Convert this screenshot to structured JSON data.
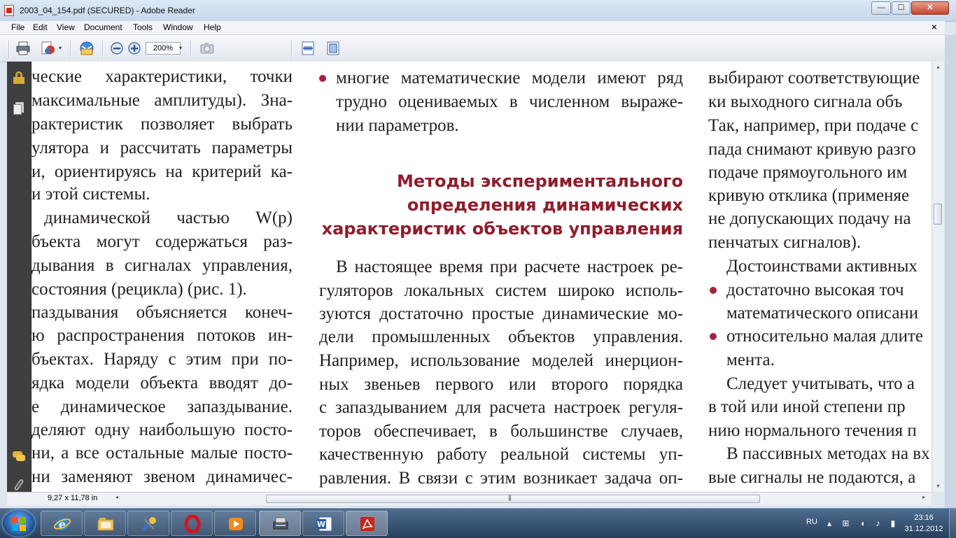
{
  "window": {
    "title": "2003_04_154.pdf (SECURED) - Adobe Reader",
    "min_glyph": "—",
    "max_glyph": "☐",
    "close_glyph": "✕"
  },
  "menu": {
    "items": [
      "File",
      "Edit",
      "View",
      "Document",
      "Tools",
      "Window",
      "Help"
    ],
    "close_glyph": "×"
  },
  "toolbar": {
    "zoom_value": "200%",
    "icons": [
      "print-icon",
      "collaborate-icon",
      "email-icon",
      "zoom-out-icon",
      "zoom-in-icon",
      "snapshot-icon",
      "fit-width-icon",
      "fit-page-icon"
    ]
  },
  "left_pane": {
    "icons": [
      "lock-icon",
      "pages-icon",
      "comment-icon",
      "attachment-icon"
    ]
  },
  "document": {
    "col1_lines": [
      "ческие характеристики, точки",
      "максимальные амплитуды). Зна-",
      "рактеристик позволяет выбрать",
      "улятора и рассчитать параметры",
      "и, ориентируясь на критерий ка-",
      "и этой системы.",
      "динамической частью W(p)",
      "бъекта могут содержаться раз-",
      "дывания в сигналах управления,",
      "состояния (рецикла) (рис. 1).",
      "паздывания объясняется конеч-",
      "ю распространения потоков ин-",
      "бъектах. Наряду с этим при по-",
      "ядка модели объекта вводят до-",
      "е динамическое запаздывание.",
      "деляют одну наибольшую посто-",
      "ни, а все остальные малые посто-",
      "ни заменяют звеном динамичес-"
    ],
    "col2_bullet_lines": [
      "многие математические модели имеют ряд",
      "трудно оцениваемых в численном выраже-",
      "нии параметров."
    ],
    "col2_heading_lines": [
      "Методы экспериментального",
      "определения динамических",
      "характеристик объектов управления"
    ],
    "col2_body_lines": [
      "В настоящее время при расчете настроек ре-",
      "гуляторов локальных систем широко исполь-",
      "зуются достаточно простые динамические мо-",
      "дели промышленных объектов управления.",
      "Например, использование моделей инерцион-",
      "ных звеньев первого или второго порядка",
      "с запаздыванием для расчета настроек регуля-",
      "торов обеспечивает, в большинстве случаев,",
      "качественную работу реальной системы уп-",
      "равления. В связи с этим возникает задача оп-"
    ],
    "col3_lines": [
      "выбирают соответствующие",
      "ки выходного сигнала объ",
      "Так, например, при подаче с",
      "пада снимают кривую разго",
      "подаче прямоугольного им",
      "кривую отклика (применяе",
      "не допускающих подачу на",
      "пенчатых сигналов).",
      "Достоинствами активных",
      "достаточно высокая точ",
      "математического описани",
      "относительно малая длите",
      "мента.",
      "Следует учитывать, что а",
      "в той или иной степени пр",
      "нию нормального течения п",
      "В пассивных методах на вх",
      "вые сигналы не подаются, а"
    ],
    "bullet_color": "#a5213b",
    "heading_color": "#8f1d2c"
  },
  "status": {
    "page_size": "9,27 x 11,78 in",
    "left_arrow": "◂",
    "right_arrow": "▸",
    "grip": "|||"
  },
  "scrollbar": {
    "up": "▴",
    "down": "▾"
  },
  "taskbar": {
    "apps": [
      "internet-explorer-icon",
      "explorer-icon",
      "tool-icon",
      "opera-icon",
      "media-player-icon",
      "scanner-icon",
      "word-icon",
      "adobe-reader-icon"
    ],
    "lang": "RU",
    "tray_glyphs": "▴ ⊞ ◖ ♪ ▮",
    "time": "23:16",
    "date": "31.12.2012"
  }
}
